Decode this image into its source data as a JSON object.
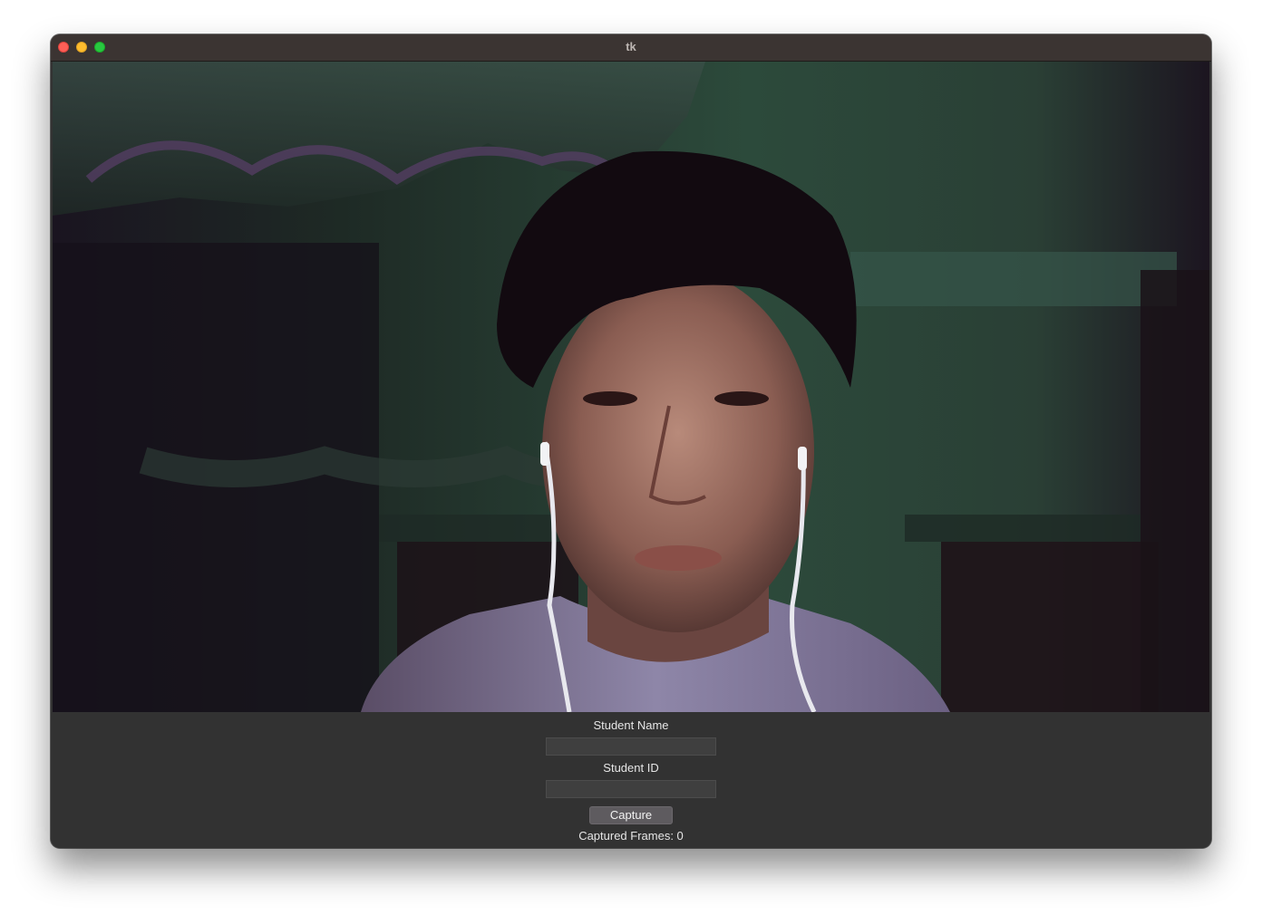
{
  "window": {
    "title": "tk"
  },
  "video_feed": {
    "description_icon": "webcam-frame"
  },
  "form": {
    "name_label": "Student Name",
    "name_value": "",
    "id_label": "Student ID",
    "id_value": "",
    "capture_label": "Capture",
    "status_text": "Captured Frames: 0"
  },
  "colors": {
    "titlebar": "#3b3432",
    "window_bg": "#323232",
    "button_bg": "#5e5b5f",
    "close": "#fe5f57",
    "minimize": "#febc2e",
    "zoom": "#28c840"
  }
}
